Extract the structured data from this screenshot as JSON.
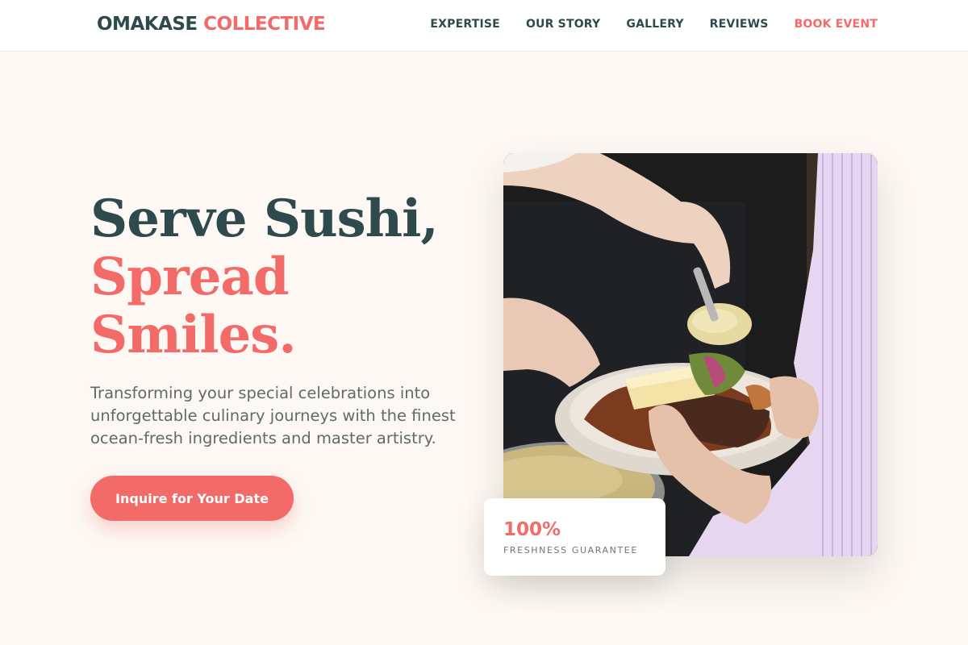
{
  "brand": {
    "name_part1": "OMAKASE",
    "name_part2": "COLLECTIVE"
  },
  "nav": {
    "items": [
      {
        "label": "EXPERTISE"
      },
      {
        "label": "OUR STORY"
      },
      {
        "label": "GALLERY"
      },
      {
        "label": "REVIEWS"
      },
      {
        "label": "BOOK EVENT"
      }
    ]
  },
  "hero": {
    "title_line1": "Serve Sushi,",
    "title_line2": "Spread",
    "title_line3": "Smiles.",
    "subtitle": "Transforming your special celebrations into unforgettable culinary journeys with the finest ocean-fresh ingredients and master artistry.",
    "cta_label": "Inquire for Your Date"
  },
  "badge": {
    "value": "100%",
    "label": "FRESHNESS GUARANTEE"
  },
  "colors": {
    "accent": "#f26b68",
    "primary": "#2f4a4c",
    "background": "#fdf8f3"
  }
}
